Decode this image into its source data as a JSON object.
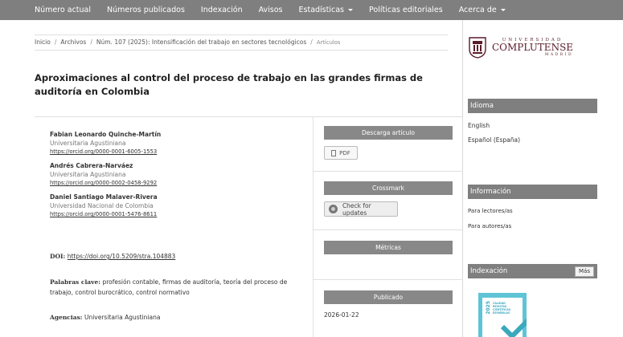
{
  "nav": {
    "items": [
      {
        "label": "Número actual",
        "dropdown": false
      },
      {
        "label": "Números publicados",
        "dropdown": false
      },
      {
        "label": "Indexación",
        "dropdown": false
      },
      {
        "label": "Avisos",
        "dropdown": false
      },
      {
        "label": "Estadísticas",
        "dropdown": true
      },
      {
        "label": "Políticas editoriales",
        "dropdown": false
      },
      {
        "label": "Acerca de",
        "dropdown": true
      }
    ]
  },
  "breadcrumb": {
    "home": "Inicio",
    "archive": "Archivos",
    "issue": "Núm. 107 (2025): Intensificación del trabajo en sectores tecnológicos",
    "current": "Artículos"
  },
  "article": {
    "title": "Aproximaciones al control del proceso de trabajo en las grandes firmas de auditoría en Colombia",
    "authors": [
      {
        "name": "Fabian Leonardo Quinche-Martín",
        "affiliation": "Universitaria Agustiniana",
        "orcid": "https://orcid.org/0000-0001-6005-1553"
      },
      {
        "name": "Andrés Cabrera-Narváez",
        "affiliation": "Universitaria Agustiniana",
        "orcid": "https://orcid.org/0000-0002-0458-9292"
      },
      {
        "name": "Daniel Santiago Malaver-Rivera",
        "affiliation": "Universidad Nacional de Colombia",
        "orcid": "https://orcid.org/0000-0001-5476-8611"
      }
    ],
    "doi_label": "DOI:",
    "doi": "https://doi.org/10.5209/stra.104883",
    "keywords_label": "Palabras clave:",
    "keywords": "profesión contable, firmas de auditoría, teoría del proceso de trabajo, control burocrático, control normativo",
    "agencias_label": "Agencias:",
    "agencias": "Universitaria Agustiniana"
  },
  "article_sidebar": {
    "download_heading": "Descarga artículo",
    "pdf_label": "PDF",
    "crossmark_heading": "Crossmark",
    "crossmark_button": "Check for updates",
    "metrics_heading": "Métricas",
    "published_heading": "Publicado",
    "published_date": "2026-01-22"
  },
  "logo": {
    "line1": "UNIVERSIDAD",
    "line2": "COMPLUTENSE",
    "line3": "MADRID"
  },
  "sidebar": {
    "language_heading": "Idioma",
    "languages": [
      "English",
      "Español (España)"
    ],
    "info_heading": "Información",
    "info_links": [
      "Para lectores/as",
      "Para autores/as"
    ],
    "index_heading": "Indexación",
    "more_button": "Más",
    "badge": {
      "year": "2025",
      "lines": [
        "CALIDAD",
        "REVISTAS",
        "CIENTÍFICAS",
        "ESPAÑOLAS"
      ]
    }
  },
  "colors": {
    "nav_bg": "#7f7f7f",
    "block_heading_bg": "#888888",
    "logo_color": "#5a1b2b",
    "badge_color": "#5ec4d6"
  }
}
